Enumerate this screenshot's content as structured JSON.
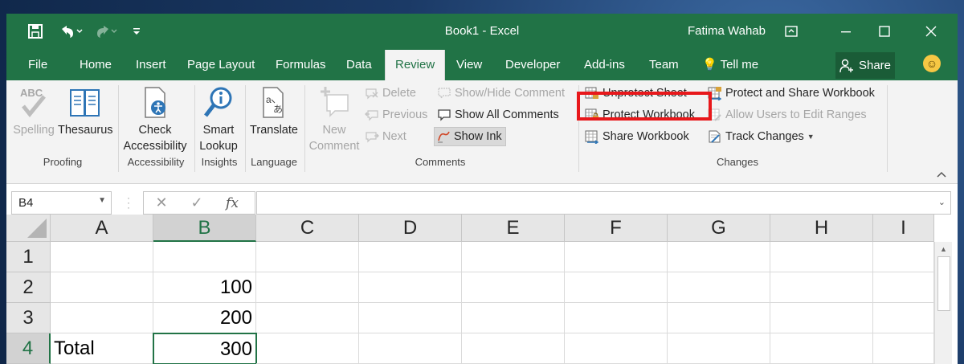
{
  "window": {
    "title": "Book1  -  Excel",
    "user": "Fatima Wahab"
  },
  "tabs": [
    "File",
    "Home",
    "Insert",
    "Page Layout",
    "Formulas",
    "Data",
    "Review",
    "View",
    "Developer",
    "Add-ins",
    "Team",
    "Tell me"
  ],
  "active_tab": "Review",
  "share_label": "Share",
  "ribbon": {
    "proofing": {
      "label": "Proofing",
      "spelling": "Spelling",
      "thesaurus": "Thesaurus",
      "abc": "ABC"
    },
    "accessibility": {
      "label": "Accessibility",
      "check_line1": "Check",
      "check_line2": "Accessibility"
    },
    "insights": {
      "label": "Insights",
      "smart_line1": "Smart",
      "smart_line2": "Lookup"
    },
    "language": {
      "label": "Language",
      "translate": "Translate"
    },
    "comments": {
      "label": "Comments",
      "new_line1": "New",
      "new_line2": "Comment",
      "delete": "Delete",
      "previous": "Previous",
      "next": "Next",
      "show_hide": "Show/Hide Comment",
      "show_all": "Show All Comments",
      "show_ink": "Show Ink"
    },
    "changes": {
      "label": "Changes",
      "unprotect_sheet": "Unprotect Sheet",
      "protect_workbook": "Protect Workbook",
      "share_workbook": "Share Workbook",
      "protect_share": "Protect and Share Workbook",
      "allow_users": "Allow Users to Edit Ranges",
      "track_changes": "Track Changes"
    }
  },
  "formula_bar": {
    "name_box": "B4",
    "formula": "",
    "cancel_symbol": "✕",
    "enter_symbol": "✓",
    "fx_symbol": "fx"
  },
  "sheet": {
    "columns": [
      "A",
      "B",
      "C",
      "D",
      "E",
      "F",
      "G",
      "H",
      "I"
    ],
    "rows": [
      "1",
      "2",
      "3",
      "4"
    ],
    "cells": {
      "A4": "Total",
      "B2": "100",
      "B3": "200",
      "B4": "300"
    },
    "selected_cell": "B4"
  },
  "colors": {
    "excel_green": "#217346",
    "highlight_red": "#e8181b"
  }
}
